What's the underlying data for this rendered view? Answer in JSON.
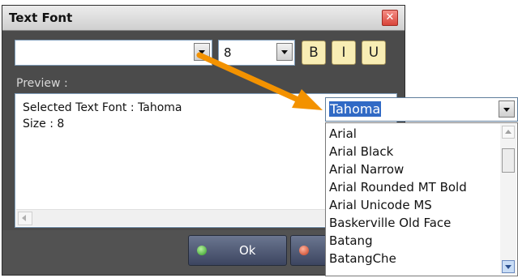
{
  "dialog": {
    "title": "Text Font",
    "close_glyph": "✕"
  },
  "font_combo": {
    "value": ""
  },
  "size_combo": {
    "value": "8"
  },
  "format_buttons": {
    "bold": "B",
    "italic": "I",
    "underline": "U"
  },
  "preview": {
    "label": "Preview :",
    "lines": [
      "Selected Text Font : Tahoma",
      "Size : 8"
    ]
  },
  "buttons": {
    "ok": "Ok",
    "cancel": ""
  },
  "dropdown": {
    "selected": "Tahoma",
    "items": [
      "Arial",
      "Arial Black",
      "Arial Narrow",
      "Arial Rounded MT Bold",
      "Arial Unicode MS",
      "Baskerville Old Face",
      "Batang",
      "BatangChe"
    ]
  },
  "colors": {
    "dialog_bg": "#4b4b4b",
    "accent_arrow": "#f39200",
    "selection": "#316ac5",
    "format_button": "#f8edb4"
  }
}
